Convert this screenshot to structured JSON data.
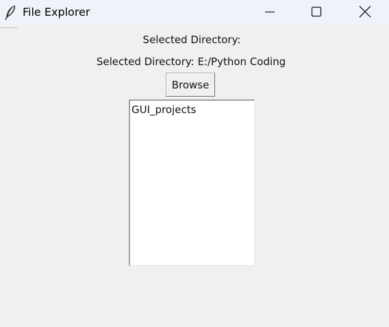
{
  "window": {
    "title": "File Explorer",
    "app_icon": "feather-icon",
    "controls": {
      "minimize": "minimize-icon",
      "maximize": "maximize-icon",
      "close": "close-icon"
    }
  },
  "main": {
    "label_heading": "Selected Directory:",
    "label_path": "Selected Directory: E:/Python Coding",
    "browse_label": "Browse",
    "list_items": [
      "GUI_projects"
    ]
  }
}
